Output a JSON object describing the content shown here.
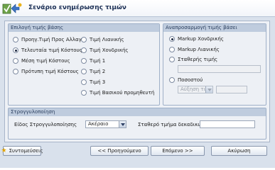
{
  "header": {
    "title": "Σενάριο ενημέρωσης τιμών"
  },
  "base_price_group": {
    "title": "Επιλογή τιμής βάσης",
    "options_left": [
      {
        "label": "Προηγ.Τιμή Προς Αλλαγή",
        "selected": false
      },
      {
        "label": "Τελευταία τιμή Κόστους",
        "selected": true
      },
      {
        "label": "Μέση τιμή Κόστους",
        "selected": false
      },
      {
        "label": "Πρότυπη τιμή Κόστους",
        "selected": false
      }
    ],
    "options_right": [
      {
        "label": "Τιμή Λιανικής",
        "selected": false
      },
      {
        "label": "Τιμή Χονδρικής",
        "selected": false
      },
      {
        "label": "Τιμή 1",
        "selected": false
      },
      {
        "label": "Τιμή 2",
        "selected": false
      },
      {
        "label": "Τιμή 3",
        "selected": false
      },
      {
        "label": "Τιμή Βασικού προμηθευτή",
        "selected": false
      }
    ]
  },
  "recalc_group": {
    "title": "Αναπροσαρμογή τιμής βάσει",
    "options": [
      {
        "label": "Markup Χονδρικής",
        "selected": true
      },
      {
        "label": "Markup Λιανικής",
        "selected": false
      },
      {
        "label": "Σταθερής τιμής",
        "selected": false
      },
      {
        "label": "Ποσοστού",
        "selected": false
      }
    ],
    "fixed_price_value": "",
    "percent_mode": "Αύξηση τι",
    "percent_value": ""
  },
  "rounding_group": {
    "title": "Στρογγυλοποίηση",
    "type_label": "Είδος Στρογγυλοποίησης",
    "type_value": "Ακέραιο",
    "decimals_label": "Σταθερό τμήμα δεκαδικών",
    "decimals_value": ""
  },
  "buttons": {
    "favorites": "Συντομεύσεις",
    "previous": "<< Προηγούμενο",
    "next": "Επόμενο >>",
    "cancel": "Ακύρωση"
  }
}
